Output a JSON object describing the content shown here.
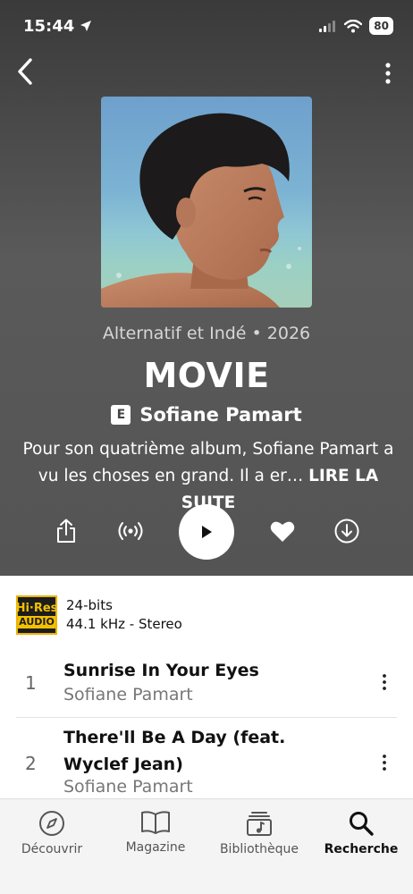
{
  "status": {
    "time": "15:44",
    "battery": "80"
  },
  "album": {
    "genre_line": "Alternatif et Indé • 2026",
    "title": "MOVIE",
    "explicit_badge": "E",
    "artist": "Sofiane Pamart",
    "description_line1": "Pour son quatrième album, Sofiane Pamart a",
    "description_line2": "vu les choses en grand. Il a er…",
    "read_more": "LIRE LA SUITE"
  },
  "quality": {
    "badge_top": "Hi·Res",
    "badge_bottom": "AUDIO",
    "bits": "24-bits",
    "format": "44.1 kHz - Stereo"
  },
  "tracks": [
    {
      "number": "1",
      "title": "Sunrise In Your Eyes",
      "artist": "Sofiane Pamart"
    },
    {
      "number": "2",
      "title_line1": "There'll Be A Day (feat.",
      "title_line2": "Wyclef Jean)",
      "artist": "Sofiane Pamart"
    }
  ],
  "tabbar": {
    "discover": "Découvrir",
    "magazine": "Magazine",
    "library": "Bibliothèque",
    "search": "Recherche"
  },
  "icons": {
    "location": "location-arrow-icon",
    "signal": "signal-icon",
    "wifi": "wifi-icon",
    "back": "chevron-left-icon",
    "more": "more-vertical-icon",
    "share": "share-icon",
    "radio": "radio-icon",
    "play": "play-icon",
    "favorite": "heart-icon",
    "download": "download-icon"
  }
}
